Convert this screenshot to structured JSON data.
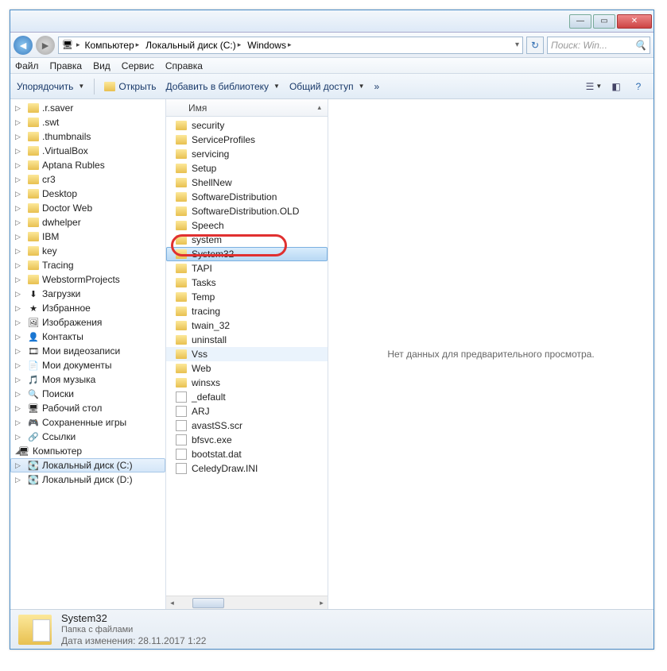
{
  "titlebar": {
    "min": "—",
    "max": "▭",
    "close": "✕"
  },
  "nav": {
    "breadcrumbs": [
      "Компьютер",
      "Локальный диск (C:)",
      "Windows"
    ],
    "search_placeholder": "Поиск: Win..."
  },
  "menu": {
    "file": "Файл",
    "edit": "Правка",
    "view": "Вид",
    "service": "Сервис",
    "help": "Справка"
  },
  "toolbar": {
    "organize": "Упорядочить",
    "open": "Открыть",
    "addlib": "Добавить в библиотеку",
    "share": "Общий доступ",
    "more": "»"
  },
  "tree": [
    {
      "t": ".r.saver",
      "i": "folder"
    },
    {
      "t": ".swt",
      "i": "folder"
    },
    {
      "t": ".thumbnails",
      "i": "folder"
    },
    {
      "t": ".VirtualBox",
      "i": "folder"
    },
    {
      "t": "Aptana Rubles",
      "i": "folder"
    },
    {
      "t": "cr3",
      "i": "folder"
    },
    {
      "t": "Desktop",
      "i": "folder"
    },
    {
      "t": "Doctor Web",
      "i": "folder"
    },
    {
      "t": "dwhelper",
      "i": "folder"
    },
    {
      "t": "IBM",
      "i": "folder"
    },
    {
      "t": "key",
      "i": "folder"
    },
    {
      "t": "Tracing",
      "i": "folder"
    },
    {
      "t": "WebstormProjects",
      "i": "folder"
    },
    {
      "t": "Загрузки",
      "i": "sys",
      "g": "⬇"
    },
    {
      "t": "Избранное",
      "i": "sys",
      "g": "★"
    },
    {
      "t": "Изображения",
      "i": "sys",
      "g": "🖼"
    },
    {
      "t": "Контакты",
      "i": "sys",
      "g": "👤"
    },
    {
      "t": "Мои видеозаписи",
      "i": "sys",
      "g": "🎞"
    },
    {
      "t": "Мои документы",
      "i": "sys",
      "g": "📄"
    },
    {
      "t": "Моя музыка",
      "i": "sys",
      "g": "🎵"
    },
    {
      "t": "Поиски",
      "i": "sys",
      "g": "🔍"
    },
    {
      "t": "Рабочий стол",
      "i": "sys",
      "g": "🖥"
    },
    {
      "t": "Сохраненные игры",
      "i": "sys",
      "g": "🎮"
    },
    {
      "t": "Ссылки",
      "i": "sys",
      "g": "🔗"
    }
  ],
  "tree_computer": "Компьютер",
  "tree_disk1": "Локальный диск (C:)",
  "tree_disk2": "Локальный диск (D:)",
  "list_header": "Имя",
  "list": [
    {
      "t": "security",
      "i": "folder"
    },
    {
      "t": "ServiceProfiles",
      "i": "folder"
    },
    {
      "t": "servicing",
      "i": "folder"
    },
    {
      "t": "Setup",
      "i": "folder"
    },
    {
      "t": "ShellNew",
      "i": "folder"
    },
    {
      "t": "SoftwareDistribution",
      "i": "folder"
    },
    {
      "t": "SoftwareDistribution.OLD",
      "i": "folder"
    },
    {
      "t": "Speech",
      "i": "folder"
    },
    {
      "t": "system",
      "i": "folder"
    },
    {
      "t": "System32",
      "i": "folder",
      "sel": true
    },
    {
      "t": "TAPI",
      "i": "folder"
    },
    {
      "t": "Tasks",
      "i": "folder"
    },
    {
      "t": "Temp",
      "i": "folder"
    },
    {
      "t": "tracing",
      "i": "folder"
    },
    {
      "t": "twain_32",
      "i": "folder"
    },
    {
      "t": "uninstall",
      "i": "folder"
    },
    {
      "t": "Vss",
      "i": "folder",
      "hov": true
    },
    {
      "t": "Web",
      "i": "folder"
    },
    {
      "t": "winsxs",
      "i": "folder"
    },
    {
      "t": "_default",
      "i": "file"
    },
    {
      "t": "ARJ",
      "i": "file"
    },
    {
      "t": "avastSS.scr",
      "i": "file"
    },
    {
      "t": "bfsvc.exe",
      "i": "file"
    },
    {
      "t": "bootstat.dat",
      "i": "file"
    },
    {
      "t": "CeledyDraw.INI",
      "i": "file"
    }
  ],
  "preview": "Нет данных для предварительного просмотра.",
  "status": {
    "name": "System32",
    "type": "Папка с файлами",
    "date_label": "Дата изменения:",
    "date": "28.11.2017 1:22"
  }
}
